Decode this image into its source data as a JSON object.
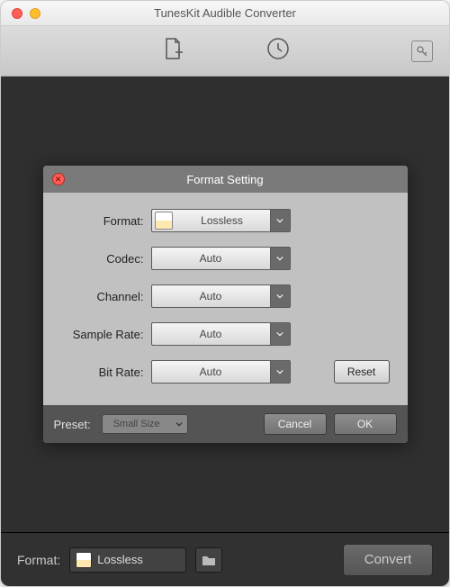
{
  "window": {
    "title": "TunesKit Audible Converter"
  },
  "dialog": {
    "title": "Format Setting",
    "rows": {
      "format": {
        "label": "Format:",
        "value": "Lossless"
      },
      "codec": {
        "label": "Codec:",
        "value": "Auto"
      },
      "channel": {
        "label": "Channel:",
        "value": "Auto"
      },
      "samplerate": {
        "label": "Sample Rate:",
        "value": "Auto"
      },
      "bitrate": {
        "label": "Bit Rate:",
        "value": "Auto"
      }
    },
    "reset": "Reset",
    "preset_label": "Preset:",
    "preset_value": "Small Size",
    "cancel": "Cancel",
    "ok": "OK"
  },
  "bottom": {
    "format_label": "Format:",
    "format_value": "Lossless",
    "convert": "Convert"
  }
}
